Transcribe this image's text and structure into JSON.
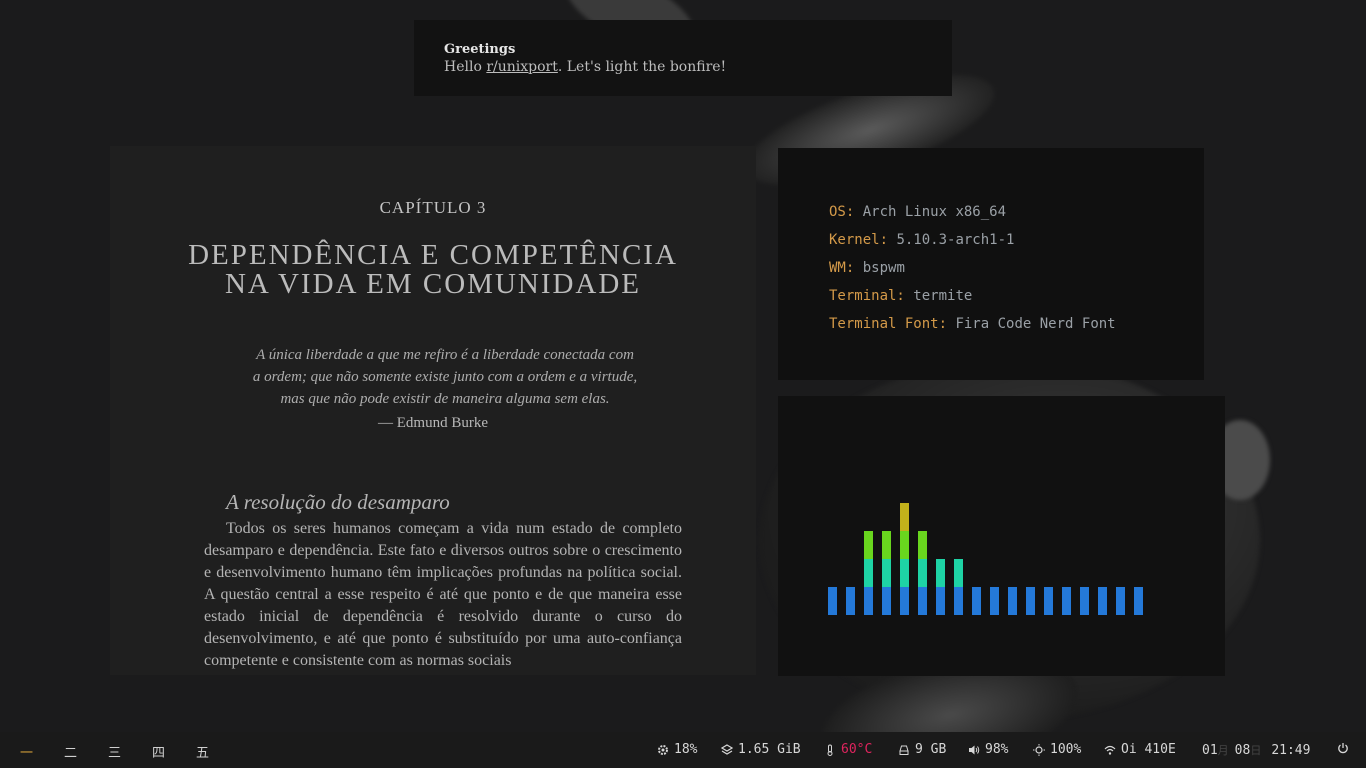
{
  "notification": {
    "title": "Greetings",
    "message_prefix": "Hello ",
    "message_link": "r/unixport",
    "message_suffix": ". Let's light the bonfire!"
  },
  "book": {
    "chapter": "CAPÍTULO 3",
    "title_line1": "DEPENDÊNCIA E COMPETÊNCIA",
    "title_line2": "NA VIDA EM COMUNIDADE",
    "quote_line1": "A única liberdade a que me refiro é a liberdade conectada com",
    "quote_line2": "a ordem; que não somente existe junto com a ordem e a virtude,",
    "quote_line3": "mas que não pode existir de maneira alguma sem elas.",
    "author": "— Edmund Burke",
    "section_title": "A resolução do desamparo",
    "paragraph": "Todos os seres humanos começam a vida num estado de completo desamparo e dependência. Este fato e diversos outros sobre o crescimento e desenvolvimento humano têm implicações profundas na política social. A questão central a esse respeito é até que ponto e de que maneira esse estado inicial de dependência é resolvido durante o curso do desenvolvimento, e até que ponto é substituído por uma auto-confiança competente e consistente com as normas sociais"
  },
  "sysinfo": {
    "rows": [
      {
        "key": "OS:",
        "value": "Arch Linux x86_64"
      },
      {
        "key": "Kernel:",
        "value": "5.10.3-arch1-1"
      },
      {
        "key": "WM:",
        "value": "bspwm"
      },
      {
        "key": "Terminal:",
        "value": "termite"
      },
      {
        "key": "Terminal Font:",
        "value": "Fira Code Nerd Font"
      }
    ]
  },
  "visualizer": {
    "levels": [
      1,
      1,
      3,
      3,
      4,
      3,
      2,
      2,
      1,
      1,
      1,
      1,
      1,
      1,
      1,
      1,
      1,
      1
    ],
    "colors": [
      "#2479d9",
      "#1ed3a5",
      "#69d61e",
      "#c2b11b"
    ]
  },
  "bar": {
    "workspaces": [
      "一",
      "二",
      "三",
      "四",
      "五"
    ],
    "active_workspace": 0,
    "cpu": "18%",
    "memory": "1.65 GiB",
    "temperature": "60°C",
    "disk": "9 GB",
    "volume": "98%",
    "brightness": "100%",
    "wifi": "Oi 410E",
    "month": "01",
    "month_char": "月",
    "day": "08",
    "day_char": "日",
    "time": "21:49",
    "accent": "#d9a33b",
    "temp_color": "#e0245e"
  }
}
